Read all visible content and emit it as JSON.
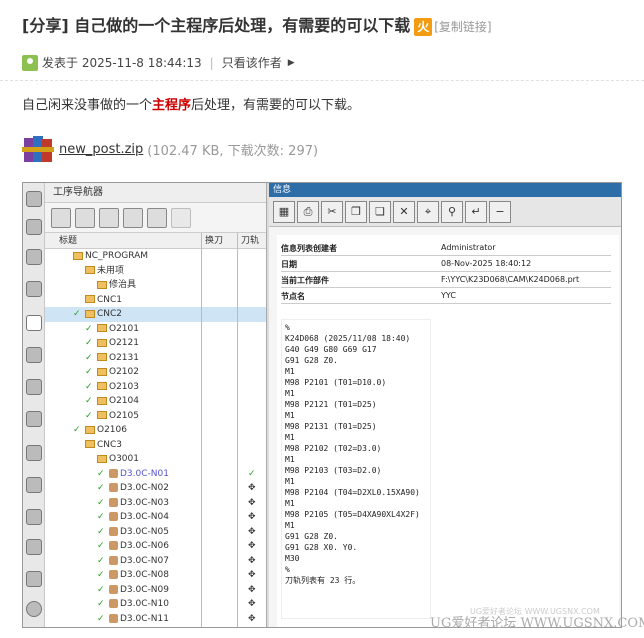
{
  "post": {
    "title": "[分享] 自己做的一个主程序后处理，有需要的可以下载",
    "badge": "火",
    "copy_link": "[复制链接]",
    "posted_label": "发表于 2025-11-8 18:44:13",
    "separator": "|",
    "author_only": "只看该作者",
    "body_before": "自己闲来没事做的一个",
    "body_highlight": "主程序",
    "body_after": "后处理，有需要的可以下载。",
    "attachment_name": "new_post.zip",
    "attachment_info": "(102.47 KB, 下载次数: 297)"
  },
  "nav": {
    "title": "工序导航器",
    "col_title": "标题",
    "col_change": "换刀",
    "col_tool": "刀轨",
    "rows": [
      {
        "label": "NC_PROGRAM",
        "indent": 0,
        "kind": "folder"
      },
      {
        "label": "未用项",
        "indent": 1,
        "kind": "folder"
      },
      {
        "label": "修治具",
        "indent": 2,
        "kind": "folder"
      },
      {
        "label": "CNC1",
        "indent": 1,
        "kind": "folder"
      },
      {
        "label": "CNC2",
        "indent": 1,
        "kind": "folder",
        "selected": true,
        "check": true
      },
      {
        "label": "O2101",
        "indent": 2,
        "kind": "folder",
        "check": true
      },
      {
        "label": "O2121",
        "indent": 2,
        "kind": "folder",
        "check": true
      },
      {
        "label": "O2131",
        "indent": 2,
        "kind": "folder",
        "check": true
      },
      {
        "label": "O2102",
        "indent": 2,
        "kind": "folder",
        "check": true
      },
      {
        "label": "O2103",
        "indent": 2,
        "kind": "folder",
        "check": true
      },
      {
        "label": "O2104",
        "indent": 2,
        "kind": "folder",
        "check": true
      },
      {
        "label": "O2105",
        "indent": 2,
        "kind": "folder",
        "check": true
      },
      {
        "label": "O2106",
        "indent": 1,
        "kind": "folder",
        "check": true
      },
      {
        "label": "CNC3",
        "indent": 1,
        "kind": "folder"
      },
      {
        "label": "O3001",
        "indent": 2,
        "kind": "folder"
      },
      {
        "label": "D3.0C-N01",
        "indent": 3,
        "kind": "op",
        "check": true,
        "blue": true,
        "tool_check": true
      },
      {
        "label": "D3.0C-N02",
        "indent": 3,
        "kind": "op",
        "check": true
      },
      {
        "label": "D3.0C-N03",
        "indent": 3,
        "kind": "op",
        "check": true
      },
      {
        "label": "D3.0C-N04",
        "indent": 3,
        "kind": "op",
        "check": true
      },
      {
        "label": "D3.0C-N05",
        "indent": 3,
        "kind": "op",
        "check": true
      },
      {
        "label": "D3.0C-N06",
        "indent": 3,
        "kind": "op",
        "check": true
      },
      {
        "label": "D3.0C-N07",
        "indent": 3,
        "kind": "op",
        "check": true
      },
      {
        "label": "D3.0C-N08",
        "indent": 3,
        "kind": "op",
        "check": true
      },
      {
        "label": "D3.0C-N09",
        "indent": 3,
        "kind": "op",
        "check": true
      },
      {
        "label": "D3.0C-N10",
        "indent": 3,
        "kind": "op",
        "check": true
      },
      {
        "label": "D3.0C-N11",
        "indent": 3,
        "kind": "op",
        "check": true
      }
    ]
  },
  "info": {
    "window_title": "信息",
    "rows": [
      {
        "key": "信息列表创建者",
        "value": "Administrator"
      },
      {
        "key": "日期",
        "value": "08-Nov-2025 18:40:12"
      },
      {
        "key": "当前工作部件",
        "value": "F:\\YYC\\K23D068\\CAM\\K24D068.prt"
      },
      {
        "key": "节点名",
        "value": "YYC"
      }
    ],
    "code": "%\nK24D068 (2025/11/08 18:40)\nG40 G49 G80 G69 G17\nG91 G28 Z0.\nM1\nM98 P2101 (T01=D10.0)\nM1\nM98 P2121 (T01=D25)\nM1\nM98 P2131 (T01=D25)\nM1\nM98 P2102 (T02=D3.0)\nM1\nM98 P2103 (T03=D2.0)\nM1\nM98 P2104 (T04=D2XL0.15XA90)\nM1\nM98 P2105 (T05=D4XA90XL4X2F)\nM1\nG91 G28 Z0.\nG91 G28 X0. Y0.\nM30\n%\n刀轨列表有 23 行。"
  },
  "watermark": "UG爱好者论坛 WWW.UGSNX.COM",
  "watermark_small": "UG爱好者论坛  WWW.UGSNX.COM"
}
